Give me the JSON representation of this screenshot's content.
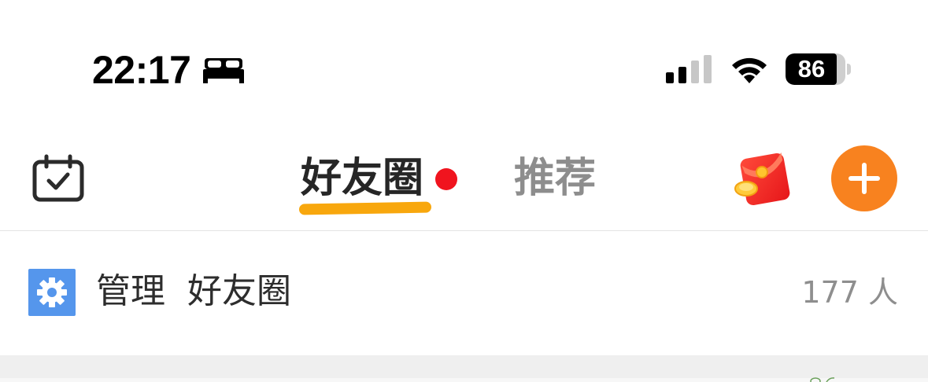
{
  "status_bar": {
    "time": "22:17",
    "focus_icon": "bed-icon",
    "battery_percent": "86",
    "battery_level": 0.86,
    "icons": [
      "signal-icon",
      "wifi-icon",
      "battery-icon"
    ]
  },
  "nav": {
    "left_icon": "calendar-check-icon",
    "tabs": [
      {
        "label": "好友圈",
        "active": true,
        "has_dot": true
      },
      {
        "label": "推荐",
        "active": false
      }
    ],
    "right_icons": [
      "red-packet-icon",
      "add-icon"
    ],
    "accent_color": "#f8821f",
    "underline_color": "#f8a70d",
    "dot_color": "#f0141e"
  },
  "manage_row": {
    "icon": "gear-icon",
    "icon_bg": "#5596ec",
    "label": "管理  好友圈",
    "count": "177 人"
  }
}
